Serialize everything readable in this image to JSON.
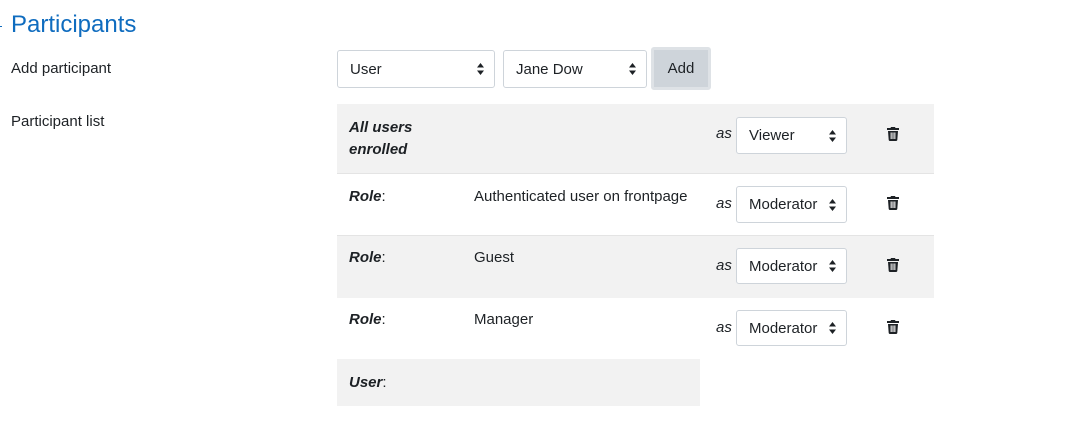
{
  "section": {
    "title": "Participants"
  },
  "add_participant": {
    "label": "Add participant",
    "type_select": {
      "value": "User"
    },
    "user_select": {
      "value": "Jane Dow"
    },
    "add_button": "Add"
  },
  "participant_list": {
    "label": "Participant list",
    "as_text": "as",
    "rows": [
      {
        "kind": "All users enrolled",
        "name": "",
        "role": "Viewer"
      },
      {
        "kind": "Role",
        "separator": ":",
        "name": "Authenticated user on frontpage",
        "role": "Moderator"
      },
      {
        "kind": "Role",
        "separator": ":",
        "name": "Guest",
        "role": "Moderator"
      },
      {
        "kind": "Role",
        "separator": ":",
        "name": "Manager",
        "role": "Moderator"
      },
      {
        "kind": "User",
        "separator": ":",
        "name": ""
      }
    ]
  },
  "icons": {
    "select_caret": "up-down-caret-icon",
    "delete": "trash-icon"
  }
}
